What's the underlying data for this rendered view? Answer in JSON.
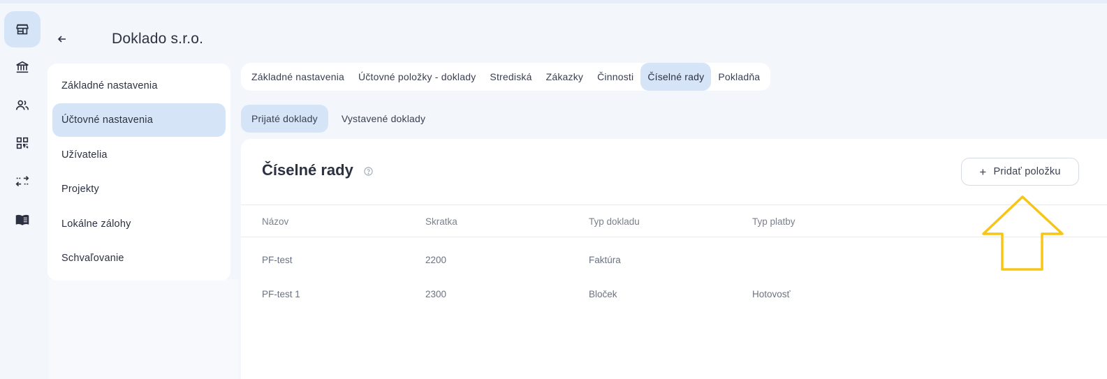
{
  "header": {
    "title": "Doklado s.r.o."
  },
  "rail": {
    "items": [
      {
        "icon": "store-icon",
        "active": true
      },
      {
        "icon": "bank-icon",
        "active": false
      },
      {
        "icon": "users-icon",
        "active": false
      },
      {
        "icon": "qr-code-icon",
        "active": false
      },
      {
        "icon": "transfer-icon",
        "active": false
      },
      {
        "icon": "book-icon",
        "active": false
      }
    ]
  },
  "sidebar": {
    "items": [
      {
        "label": "Základné nastavenia"
      },
      {
        "label": "Účtovné nastavenia"
      },
      {
        "label": "Užívatelia"
      },
      {
        "label": "Projekty"
      },
      {
        "label": "Lokálne zálohy"
      },
      {
        "label": "Schvaľovanie"
      }
    ],
    "active_index": 1
  },
  "tabs": {
    "items": [
      {
        "label": "Základné nastavenia"
      },
      {
        "label": "Účtovné položky - doklady"
      },
      {
        "label": "Strediská"
      },
      {
        "label": "Zákazky"
      },
      {
        "label": "Činnosti"
      },
      {
        "label": "Číselné rady"
      },
      {
        "label": "Pokladňa"
      }
    ],
    "active_index": 5
  },
  "subtabs": {
    "items": [
      {
        "label": "Prijaté doklady"
      },
      {
        "label": "Vystavené doklady"
      }
    ],
    "active_index": 0
  },
  "section": {
    "title": "Číselné rady",
    "add_button_label": "Pridať položku",
    "add_button_icon": "+"
  },
  "table": {
    "columns": [
      "Názov",
      "Skratka",
      "Typ dokladu",
      "Typ platby"
    ],
    "rows": [
      [
        "PF-test",
        "2200",
        "Faktúra",
        ""
      ],
      [
        "PF-test 1",
        "2300",
        "Bloček",
        "Hotovosť"
      ]
    ]
  },
  "colors": {
    "accent_bg": "#d5e4f7",
    "page_bg": "#f3f6fb",
    "arrow": "#f6c516"
  }
}
